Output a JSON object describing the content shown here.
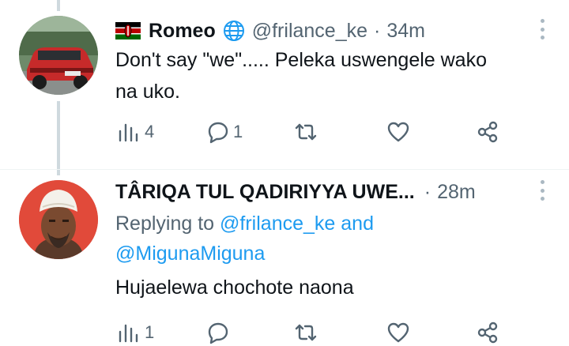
{
  "tweets": [
    {
      "display_name": "Romeo",
      "handle": "@frilance_ke",
      "separator": "·",
      "time": "34m",
      "text": "Don't say \"we\"..... Peleka uswengele wako na uko.",
      "text_line1": "Don't say \"we\"..... Peleka uswengele wako",
      "text_line2": "na uko.",
      "stats": {
        "views": "4",
        "replies": "1"
      }
    },
    {
      "display_name": "TÂRIQA TUL QADIRIYYA UWE...",
      "separator": "·",
      "time": "28m",
      "replying_prefix": "Replying to ",
      "replying_user1": "@frilance_ke",
      "replying_and": " and",
      "replying_user2": "@MigunaMiguna",
      "text": "Hujaelewa chochote naona",
      "stats": {
        "views": "1"
      }
    }
  ],
  "colors": {
    "accent": "#1d9bf0",
    "muted": "#536471",
    "thread_line": "#cfd9de",
    "text": "#0f1419"
  },
  "icons": [
    "kenya-flag-icon",
    "globe-icon",
    "more-icon",
    "views-icon",
    "reply-icon",
    "retweet-icon",
    "like-icon",
    "share-icon"
  ]
}
